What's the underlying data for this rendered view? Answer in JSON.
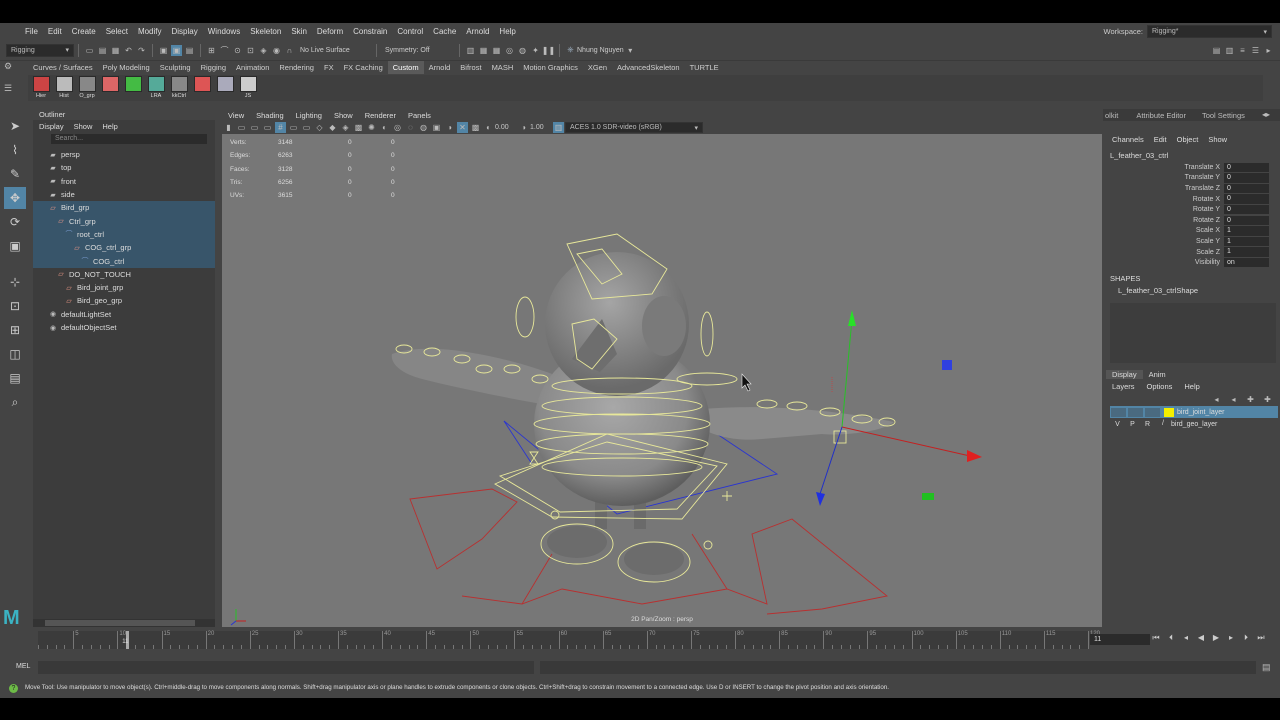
{
  "menubar": {
    "items": [
      "File",
      "Edit",
      "Create",
      "Select",
      "Modify",
      "Display",
      "Windows",
      "Skeleton",
      "Skin",
      "Deform",
      "Constrain",
      "Control",
      "Cache",
      "Arnold",
      "Help"
    ],
    "workspace_label": "Workspace:",
    "workspace_value": "Rigging*"
  },
  "statusline": {
    "menuset": "Rigging",
    "live_surface": "No Live Surface",
    "symmetry": "Symmetry: Off",
    "user": "Nhung Nguyen"
  },
  "shelf": {
    "tabs": [
      "Curves / Surfaces",
      "Poly Modeling",
      "Sculpting",
      "Rigging",
      "Animation",
      "Rendering",
      "FX",
      "FX Caching",
      "Custom",
      "Arnold",
      "Bifrost",
      "MASH",
      "Motion Graphics",
      "XGen",
      "AdvancedSkeleton",
      "TURTLE"
    ],
    "active_tab": "Custom",
    "buttons": [
      "Hier",
      "Hist",
      "O_grp",
      "",
      "",
      "LRA",
      "kkCtrl",
      "",
      "",
      "JS"
    ]
  },
  "outliner": {
    "title": "Outliner",
    "menu": [
      "Display",
      "Show",
      "Help"
    ],
    "search_placeholder": "Search...",
    "items": [
      {
        "label": "persp",
        "indent": 1,
        "selected": false,
        "icon": "camera"
      },
      {
        "label": "top",
        "indent": 1,
        "selected": false,
        "icon": "camera"
      },
      {
        "label": "front",
        "indent": 1,
        "selected": false,
        "icon": "camera"
      },
      {
        "label": "side",
        "indent": 1,
        "selected": false,
        "icon": "camera"
      },
      {
        "label": "Bird_grp",
        "indent": 1,
        "selected": true,
        "icon": "group"
      },
      {
        "label": "Ctrl_grp",
        "indent": 2,
        "selected": true,
        "icon": "group"
      },
      {
        "label": "root_ctrl",
        "indent": 3,
        "selected": true,
        "icon": "curve"
      },
      {
        "label": "COG_ctrl_grp",
        "indent": 4,
        "selected": true,
        "icon": "group"
      },
      {
        "label": "COG_ctrl",
        "indent": 5,
        "selected": true,
        "icon": "curve"
      },
      {
        "label": "DO_NOT_TOUCH",
        "indent": 2,
        "selected": false,
        "icon": "group"
      },
      {
        "label": "Bird_joint_grp",
        "indent": 3,
        "selected": false,
        "icon": "group"
      },
      {
        "label": "Bird_geo_grp",
        "indent": 3,
        "selected": false,
        "icon": "group"
      },
      {
        "label": "defaultLightSet",
        "indent": 1,
        "selected": false,
        "icon": "set"
      },
      {
        "label": "defaultObjectSet",
        "indent": 1,
        "selected": false,
        "icon": "set"
      }
    ]
  },
  "viewport": {
    "menu": [
      "View",
      "Shading",
      "Lighting",
      "Show",
      "Renderer",
      "Panels"
    ],
    "exposure": "0.00",
    "gamma": "1.00",
    "color_space": "ACES 1.0 SDR-video (sRGB)",
    "hud": [
      {
        "label": "Verts:",
        "v": "3148",
        "a": "0",
        "b": "0"
      },
      {
        "label": "Edges:",
        "v": "6263",
        "a": "0",
        "b": "0"
      },
      {
        "label": "Faces:",
        "v": "3128",
        "a": "0",
        "b": "0"
      },
      {
        "label": "Tris:",
        "v": "6256",
        "a": "0",
        "b": "0"
      },
      {
        "label": "UVs:",
        "v": "3615",
        "a": "0",
        "b": "0"
      }
    ],
    "camera_label": "2D Pan/Zoom : persp"
  },
  "right_tabs": [
    "olkit",
    "Attribute Editor",
    "Tool Settings"
  ],
  "channelbox": {
    "menu": [
      "Channels",
      "Edit",
      "Object",
      "Show"
    ],
    "object": "L_feather_03_ctrl",
    "attrs": [
      {
        "name": "Translate X",
        "value": "0"
      },
      {
        "name": "Translate Y",
        "value": "0"
      },
      {
        "name": "Translate Z",
        "value": "0"
      },
      {
        "name": "Rotate X",
        "value": "0"
      },
      {
        "name": "Rotate Y",
        "value": "0"
      },
      {
        "name": "Rotate Z",
        "value": "0"
      },
      {
        "name": "Scale X",
        "value": "1"
      },
      {
        "name": "Scale Y",
        "value": "1"
      },
      {
        "name": "Scale Z",
        "value": "1"
      },
      {
        "name": "Visibility",
        "value": "on"
      }
    ],
    "shapes_header": "SHAPES",
    "shape": "L_feather_03_ctrlShape"
  },
  "layers": {
    "tabs": [
      "Display",
      "Anim"
    ],
    "menu": [
      "Layers",
      "Options",
      "Help"
    ],
    "rows": [
      {
        "v": "",
        "p": "",
        "r": "",
        "name": "bird_joint_layer",
        "color": "#f4f000",
        "selected": true
      },
      {
        "v": "V",
        "p": "P",
        "r": "R",
        "name": "bird_geo_layer",
        "color": "",
        "selected": false
      }
    ]
  },
  "timeline": {
    "ticks": [
      "5",
      "10",
      "15",
      "20",
      "25",
      "30",
      "35",
      "40",
      "45",
      "50",
      "55",
      "60",
      "65",
      "70",
      "75",
      "80",
      "85",
      "90",
      "95",
      "100",
      "105",
      "110",
      "115",
      "120"
    ],
    "current_frame_marker": "11",
    "current_frame": "11",
    "start": 1,
    "end": 120
  },
  "cmdline": {
    "label": "MEL"
  },
  "helpline": {
    "text": "Move Tool: Use manipulator to move object(s). Ctrl+middle-drag to move components along normals. Shift+drag manipulator axis or plane handles to extrude components or clone objects. Ctrl+Shift+drag to constrain movement to a connected edge. Use D or INSERT to change the pivot position and axis orientation."
  },
  "colors": {
    "selection": "#5285a6",
    "wire_yellow": "#e8e89a",
    "wire_red": "#c0302a",
    "wire_blue": "#2a35d0"
  }
}
